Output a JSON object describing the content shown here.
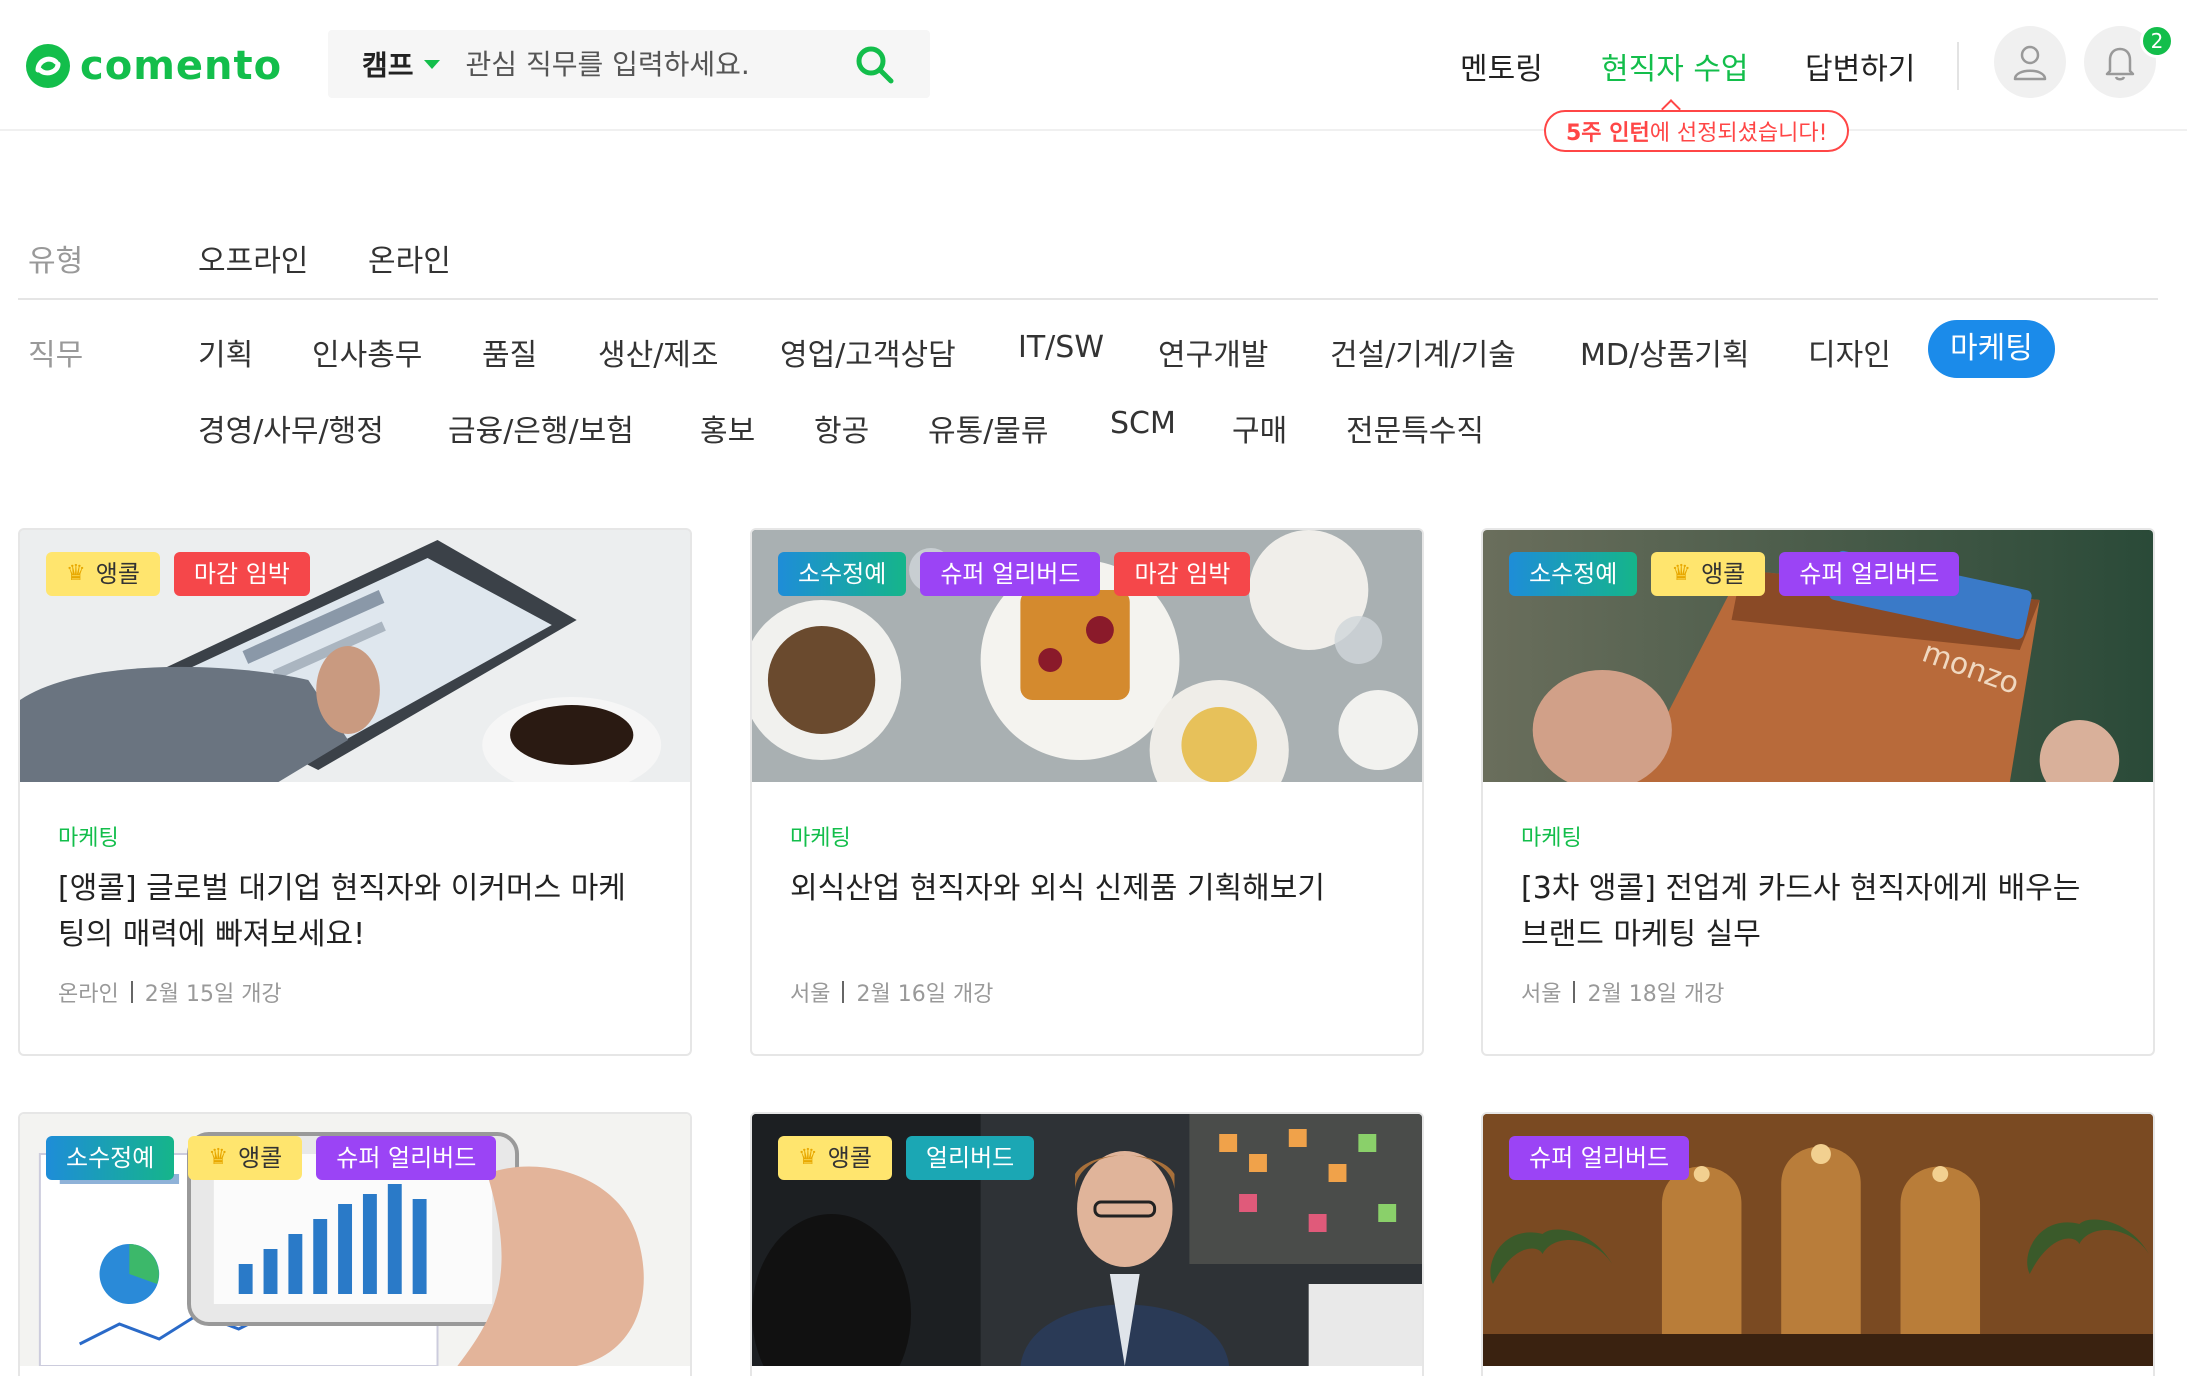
{
  "brand": {
    "logo_text": "comento",
    "color": "#13be4b"
  },
  "search": {
    "category": "캠프",
    "placeholder": "관심 직무를 입력하세요."
  },
  "nav": [
    {
      "label": "멘토링",
      "active": false
    },
    {
      "label": "현직자 수업",
      "active": true
    },
    {
      "label": "답변하기",
      "active": false
    }
  ],
  "notifications": {
    "count": "2"
  },
  "tooltip": {
    "bold": "5주 인턴",
    "rest": "에 선정되셨습니다!"
  },
  "filters": {
    "type_label": "유형",
    "types": [
      "오프라인",
      "온라인"
    ],
    "job_label": "직무",
    "jobs_row1": [
      "기획",
      "인사총무",
      "품질",
      "생산/제조",
      "영업/고객상담",
      "IT/SW",
      "연구개발",
      "건설/기계/기술",
      "MD/상품기획",
      "디자인",
      "마케팅"
    ],
    "jobs_row2": [
      "경영/사무/행정",
      "금융/은행/보험",
      "홍보",
      "항공",
      "유통/물류",
      "SCM",
      "구매",
      "전문특수직"
    ],
    "active_job": "마케팅"
  },
  "cards": [
    {
      "tags": [
        {
          "label": "앵콜",
          "style": "crown"
        },
        {
          "label": "마감 임박",
          "style": "red"
        }
      ],
      "image": "tablet-coffee-photo",
      "category": "마케팅",
      "title": "[앵콜] 글로벌 대기업 현직자와 이커머스 마케팅의 매력에 빠져보세요!",
      "location": "온라인",
      "date": "2월 15일 개강"
    },
    {
      "tags": [
        {
          "label": "소수정예",
          "style": "grad"
        },
        {
          "label": "슈퍼 얼리버드",
          "style": "purple"
        },
        {
          "label": "마감 임박",
          "style": "red"
        }
      ],
      "image": "waffle-brunch-photo",
      "category": "마케팅",
      "title": "외식산업 현직자와 외식 신제품 기획해보기",
      "location": "서울",
      "date": "2월 16일 개강"
    },
    {
      "tags": [
        {
          "label": "소수정예",
          "style": "grad"
        },
        {
          "label": "앵콜",
          "style": "crown"
        },
        {
          "label": "슈퍼 얼리버드",
          "style": "purple"
        }
      ],
      "image": "leather-wallet-photo",
      "category": "마케팅",
      "title": "[3차 앵콜] 전업계 카드사 현직자에게 배우는 브랜드 마케팅 실무",
      "location": "서울",
      "date": "2월 18일 개강"
    },
    {
      "tags": [
        {
          "label": "소수정예",
          "style": "grad"
        },
        {
          "label": "앵콜",
          "style": "crown"
        },
        {
          "label": "슈퍼 얼리버드",
          "style": "purple"
        }
      ],
      "image": "phone-analytics-photo"
    },
    {
      "tags": [
        {
          "label": "앵콜",
          "style": "crown"
        },
        {
          "label": "얼리버드",
          "style": "teal"
        }
      ],
      "image": "meeting-man-photo"
    },
    {
      "tags": [
        {
          "label": "슈퍼 얼리버드",
          "style": "purple"
        }
      ],
      "image": "palace-hall-photo"
    }
  ]
}
